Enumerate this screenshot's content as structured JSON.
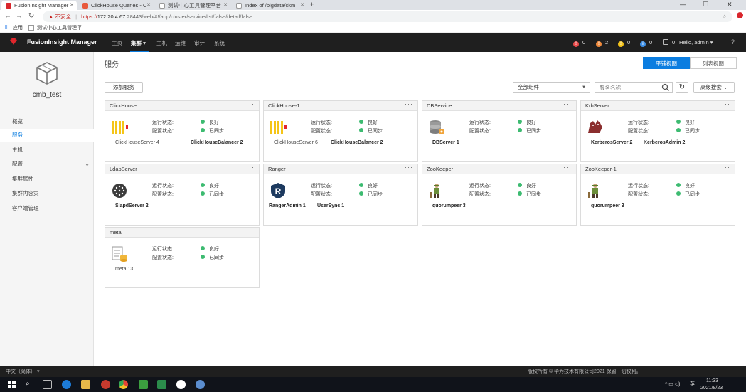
{
  "browser": {
    "tabs": [
      {
        "title": "FusionInsight Manager",
        "active": true
      },
      {
        "title": "ClickHouse Queries - C",
        "active": false
      },
      {
        "title": "测试中心工具管理平台",
        "active": false
      },
      {
        "title": "Index of /bigdata/ckm",
        "active": false
      }
    ],
    "address": {
      "warning": "不安全",
      "scheme": "https://",
      "host": "172.20.4.67",
      "path": ":28443/web/#!/app/cluster/service/list/false/detail/false"
    },
    "bookmarks": [
      "应用",
      "测试中心工具管理平"
    ],
    "controls": {
      "min": "—",
      "max": "☐",
      "close": "✕",
      "new_tab": "+"
    }
  },
  "header": {
    "brand": "FusionInsight Manager",
    "nav": [
      {
        "label": "主页",
        "active": false
      },
      {
        "label": "集群 ▾",
        "active": true
      },
      {
        "label": "主机",
        "active": false
      },
      {
        "label": "运维",
        "active": false
      },
      {
        "label": "审计",
        "active": false
      },
      {
        "label": "系统",
        "active": false
      }
    ],
    "alarms": [
      {
        "icon": "critical-alarm",
        "color": "#e84a4a",
        "count": "0"
      },
      {
        "icon": "major-alarm",
        "color": "#f08a3c",
        "count": "2"
      },
      {
        "icon": "minor-alarm",
        "color": "#f3c31a",
        "count": "0"
      },
      {
        "icon": "info-alarm",
        "color": "#3d8fe6",
        "count": "0"
      },
      {
        "icon": "task-list",
        "color": "#bbbbbb",
        "count": "0"
      }
    ],
    "user": "Hello, admin ▾",
    "help": "?"
  },
  "sidebar": {
    "cluster_name": "cmb_test",
    "items": [
      {
        "label": "概览",
        "active": false
      },
      {
        "label": "服务",
        "active": true
      },
      {
        "label": "主机",
        "active": false
      },
      {
        "label": "配置",
        "active": false,
        "expandable": true
      },
      {
        "label": "集群属性",
        "active": false
      },
      {
        "label": "集群内容灾",
        "active": false
      },
      {
        "label": "客户端管理",
        "active": false
      }
    ]
  },
  "main": {
    "title": "服务",
    "view_tile": "平铺视图",
    "view_list": "列表视图",
    "add_service": "添加服务",
    "component_filter": "全部组件",
    "search_placeholder": "服务名称",
    "advanced_search": "高级搜索 ⌄",
    "status_labels": {
      "run": "运行状态:",
      "config": "配置状态:"
    },
    "status_values": {
      "run": "良好",
      "config": "已同步"
    },
    "more": "···"
  },
  "services": [
    {
      "name": "ClickHouse",
      "icon": "clickhouse-icon",
      "roles": [
        {
          "text": "ClickHouseServer 4",
          "bold": false
        },
        {
          "text": "ClickHouseBalancer 2",
          "bold": true
        }
      ]
    },
    {
      "name": "ClickHouse-1",
      "icon": "clickhouse-icon",
      "roles": [
        {
          "text": "ClickHouseServer 6",
          "bold": false
        },
        {
          "text": "ClickHouseBalancer 2",
          "bold": true
        }
      ]
    },
    {
      "name": "DBService",
      "icon": "database-icon",
      "roles": [
        {
          "text": "DBServer 1",
          "bold": true
        }
      ]
    },
    {
      "name": "KrbServer",
      "icon": "kerberos-icon",
      "roles": [
        {
          "text": "KerberosServer 2",
          "bold": true
        },
        {
          "text": "KerberosAdmin 2",
          "bold": true
        }
      ]
    },
    {
      "name": "LdapServer",
      "icon": "ldap-icon",
      "roles": [
        {
          "text": "SlapdServer 2",
          "bold": true
        }
      ]
    },
    {
      "name": "Ranger",
      "icon": "ranger-icon",
      "roles": [
        {
          "text": "RangerAdmin 1",
          "bold": true
        },
        {
          "text": "UserSync 1",
          "bold": true
        }
      ]
    },
    {
      "name": "ZooKeeper",
      "icon": "zookeeper-icon",
      "roles": [
        {
          "text": "quorumpeer 3",
          "bold": true
        }
      ]
    },
    {
      "name": "ZooKeeper-1",
      "icon": "zookeeper-icon",
      "roles": [
        {
          "text": "quorumpeer 3",
          "bold": true
        }
      ]
    },
    {
      "name": "meta",
      "icon": "meta-icon",
      "roles": [
        {
          "text": "meta 13",
          "bold": false
        }
      ]
    }
  ],
  "footer": {
    "language": "中文（简体） ▾",
    "copyright": "版权所有 © 华为技术有限公司2021 保留一切权利。"
  },
  "taskbar": {
    "ime": "英",
    "time": "11:33",
    "date": "2021/8/23"
  }
}
